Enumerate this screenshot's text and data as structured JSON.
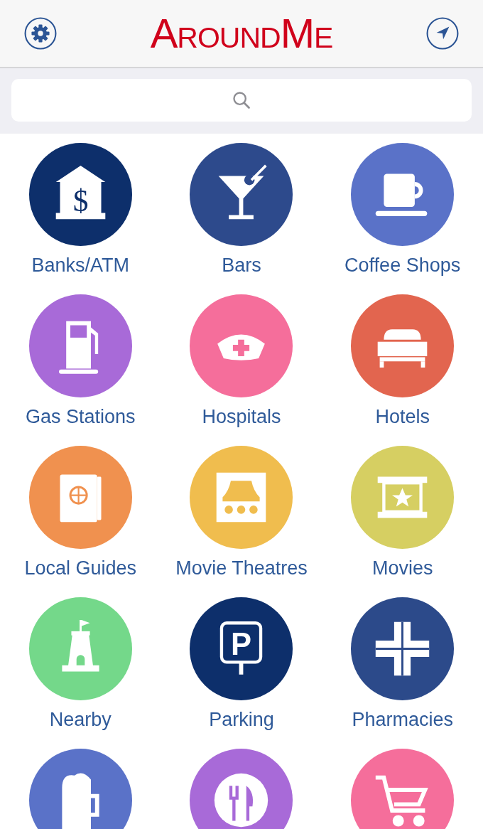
{
  "header": {
    "title": "AroundMe"
  },
  "categories": [
    {
      "kind": "bank",
      "label": "Banks/ATM",
      "color": "#0d2f6b",
      "symbol": "$"
    },
    {
      "kind": "bar",
      "label": "Bars",
      "color": "#2d4a8c"
    },
    {
      "kind": "coffee",
      "label": "Coffee Shops",
      "color": "#5a72c8"
    },
    {
      "kind": "gas",
      "label": "Gas Stations",
      "color": "#a86ad8"
    },
    {
      "kind": "hospital",
      "label": "Hospitals",
      "color": "#f56e9b"
    },
    {
      "kind": "hotel",
      "label": "Hotels",
      "color": "#e2654f"
    },
    {
      "kind": "guide",
      "label": "Local Guides",
      "color": "#f0914f"
    },
    {
      "kind": "theatre",
      "label": "Movie Theatres",
      "color": "#f0bd4e"
    },
    {
      "kind": "movie",
      "label": "Movies",
      "color": "#d6cf62"
    },
    {
      "kind": "nearby",
      "label": "Nearby",
      "color": "#74d88a"
    },
    {
      "kind": "parking",
      "label": "Parking",
      "color": "#0d2f6b",
      "symbol": "P"
    },
    {
      "kind": "pharmacy",
      "label": "Pharmacies",
      "color": "#2c4a8a"
    },
    {
      "kind": "pub",
      "color": "#5a72c8"
    },
    {
      "kind": "restaurant",
      "color": "#a86ad8"
    },
    {
      "kind": "shopping",
      "color": "#f56e9b"
    }
  ]
}
